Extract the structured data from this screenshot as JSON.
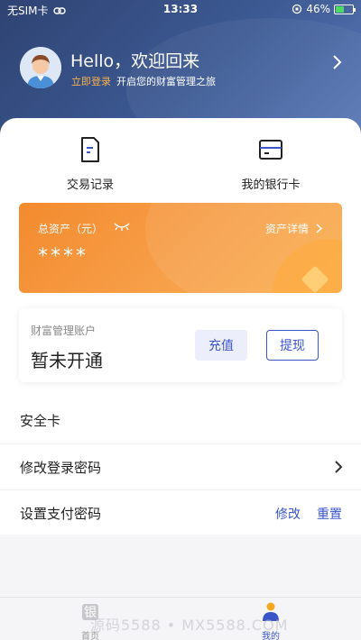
{
  "status_bar": {
    "carrier": "无SIM卡",
    "time": "13:33",
    "battery": "46%"
  },
  "header": {
    "greeting": "Hello，欢迎回来",
    "login_link": "立即登录",
    "subtitle": "开启您的财富管理之旅"
  },
  "quick_actions": [
    {
      "label": "交易记录",
      "icon": "document-icon"
    },
    {
      "label": "我的银行卡",
      "icon": "bank-card-icon"
    }
  ],
  "asset_card": {
    "total_label": "总资产（元）",
    "detail_label": "资产详情",
    "masked_value": "****"
  },
  "finance_account": {
    "title": "财富管理账户",
    "status": "暂未开通",
    "recharge_label": "充值",
    "withdraw_label": "提现"
  },
  "settings": {
    "security_card": "安全卡",
    "change_login_password": "修改登录密码",
    "set_pay_password": "设置支付密码",
    "modify_label": "修改",
    "reset_label": "重置"
  },
  "tab_bar": {
    "home": "首页",
    "mine": "我的"
  },
  "watermark": "源码5588 • MX5588.COM",
  "colors": {
    "header": "#3d5a94",
    "accent": "#3b55c9",
    "card_orange": "#f38a2e",
    "login_link": "#f7b24a"
  }
}
